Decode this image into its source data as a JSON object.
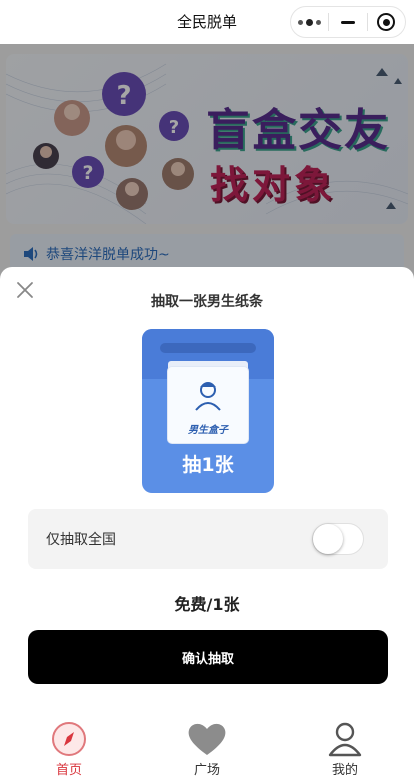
{
  "navbar": {
    "title": "全民脱单",
    "capsule_icons": [
      "more-icon",
      "minimize-icon",
      "close-miniprogram-icon"
    ]
  },
  "background": {
    "banner": {
      "title_line1": "盲盒交友",
      "title_line2": "找对象"
    },
    "notice": {
      "icon": "speaker-icon",
      "text": "恭喜洋洋脱单成功~"
    }
  },
  "sheet": {
    "close_icon": "close-icon",
    "title": "抽取一张男生纸条",
    "card": {
      "box_label": "男生盒子",
      "draw_text": "抽1张"
    },
    "toggle": {
      "label": "仅抽取全国",
      "on": false
    },
    "price": "免费/1张",
    "confirm_label": "确认抽取"
  },
  "tabbar": {
    "items": [
      {
        "label": "首页",
        "icon": "compass-icon",
        "active": true
      },
      {
        "label": "广场",
        "icon": "heart-icon",
        "active": false
      },
      {
        "label": "我的",
        "icon": "person-icon",
        "active": false
      }
    ]
  },
  "colors": {
    "accent_red": "#d9363e",
    "card_blue": "#5b8fe6",
    "button_black": "#000000"
  }
}
